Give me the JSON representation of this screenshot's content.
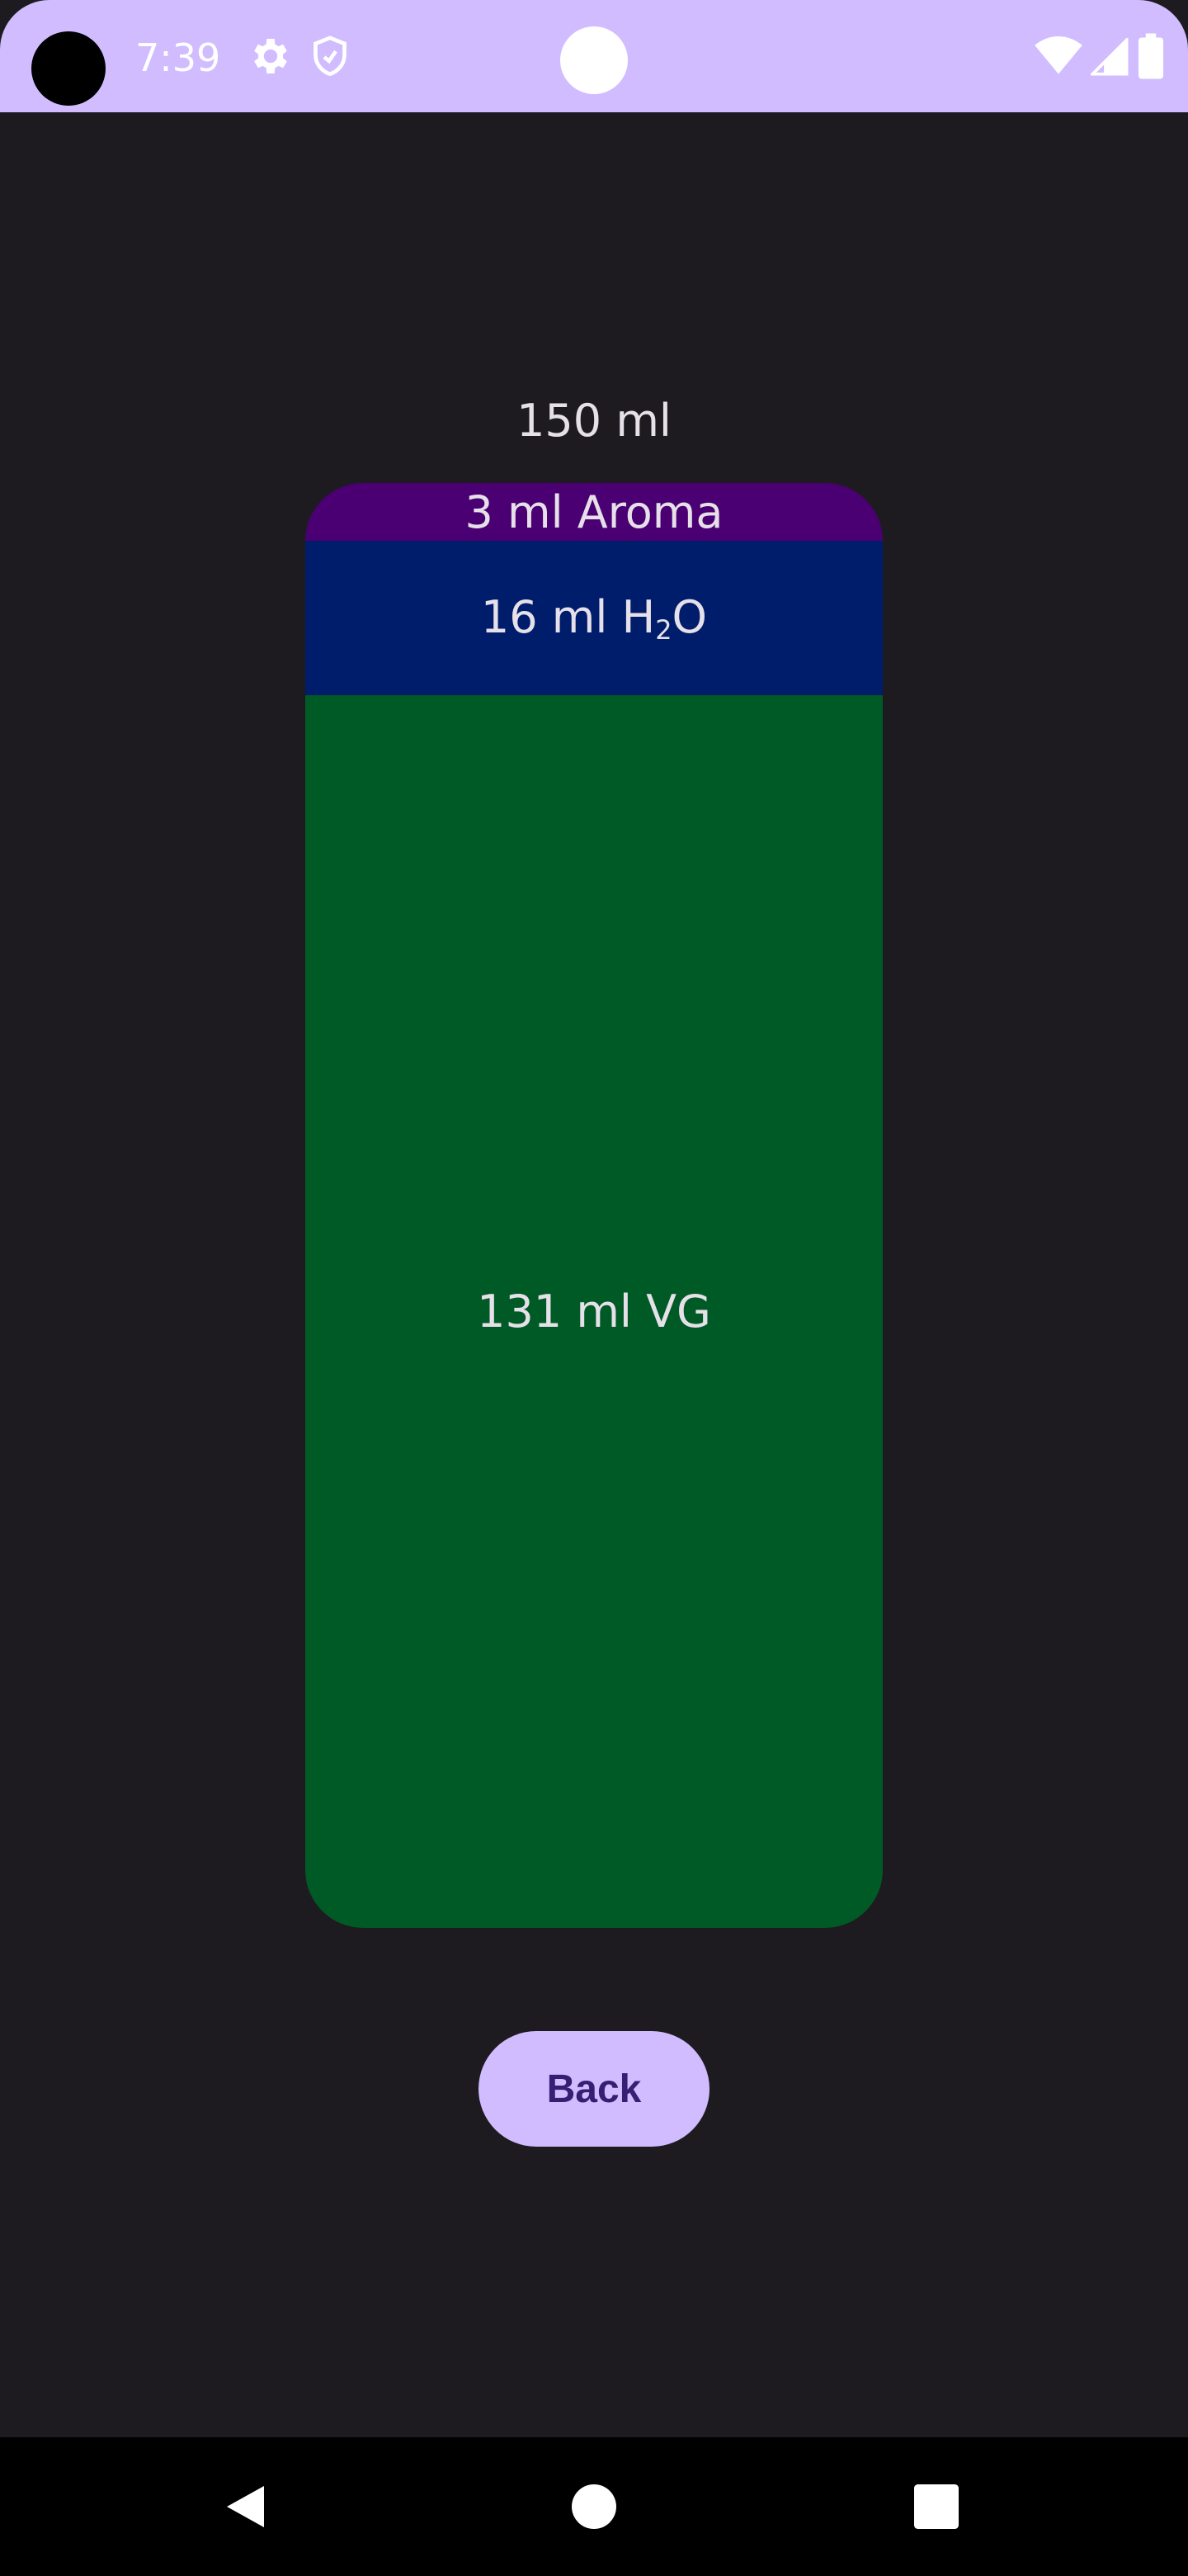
{
  "status_bar": {
    "time": "7:39",
    "icons": [
      "gear-icon",
      "shield-icon",
      "wifi-icon",
      "signal-icon",
      "battery-icon"
    ],
    "background": "#d0bcff"
  },
  "mixture": {
    "total": "150 ml",
    "layers": {
      "aroma": {
        "amount": "3 ml Aroma",
        "color": "#4a0072"
      },
      "water": {
        "prefix": "16 ml H",
        "subscript": "2",
        "suffix": "O",
        "color": "#001d6c"
      },
      "vg": {
        "amount": "131 ml VG",
        "color": "#005a25"
      }
    }
  },
  "actions": {
    "back_label": "Back"
  },
  "nav_bar": {
    "buttons": [
      "back-triangle-icon",
      "home-circle-icon",
      "recents-square-icon"
    ]
  }
}
